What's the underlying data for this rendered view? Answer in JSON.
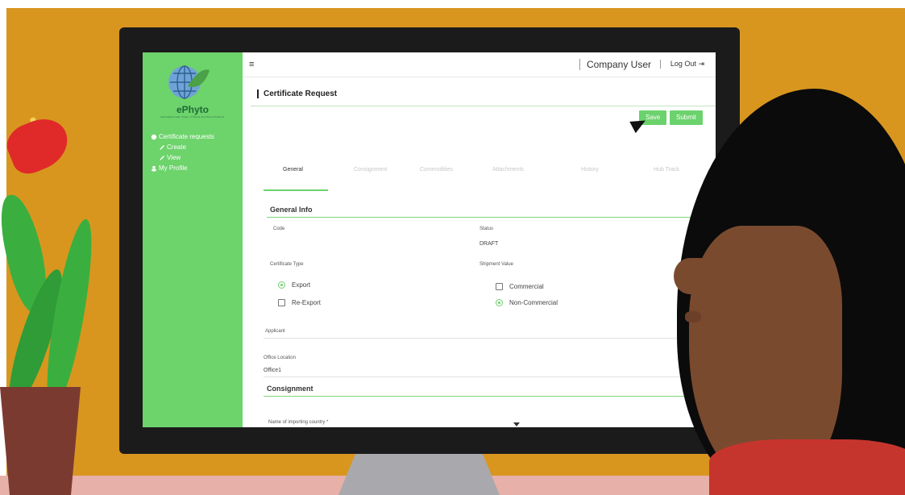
{
  "app": {
    "brand": "ePhyto",
    "tagline": "Facilitating Safe Trade of Plants and Plant Products",
    "topbar": {
      "menu_icon": "hamburger-icon",
      "user_label": "Company User",
      "logout_label": "Log Out",
      "logout_icon": "logout-icon"
    },
    "sidebar": {
      "items": [
        {
          "label": "Certificate requests",
          "icon": "globe-icon"
        },
        {
          "label": "Create",
          "icon": "pencil-icon"
        },
        {
          "label": "View",
          "icon": "pencil-icon"
        },
        {
          "label": "My Profile",
          "icon": "user-icon"
        }
      ]
    },
    "page": {
      "title": "Certificate Request",
      "actions": {
        "save": "Save",
        "submit": "Submit"
      },
      "tabs": [
        "General",
        "Consignment",
        "Commodities",
        "Attachments",
        "History",
        "Hub Track"
      ],
      "general_info": {
        "heading": "General Info",
        "code_label": "Code",
        "status_label": "Status",
        "status_value": "DRAFT",
        "certificate_type_label": "Certificate Type",
        "certificate_type_options": [
          {
            "label": "Export",
            "selected": true
          },
          {
            "label": "Re-Export",
            "selected": false
          }
        ],
        "shipment_value_label": "Shipment Value",
        "shipment_value_options": [
          {
            "label": "Commercial",
            "selected": false
          },
          {
            "label": "Non-Commercial",
            "selected": true
          }
        ],
        "applicant_label": "Applicant",
        "office_location_label": "Office Location",
        "office_location_value": "Office1"
      },
      "consignment": {
        "heading": "Consignment",
        "importing_country_label": "Name of importing country *"
      }
    }
  },
  "colors": {
    "sidebar_bg": "#6dd36b",
    "accent_green": "#6bd26c",
    "wall_orange": "#d8961f",
    "monitor_bezel": "#1b1b1b"
  }
}
